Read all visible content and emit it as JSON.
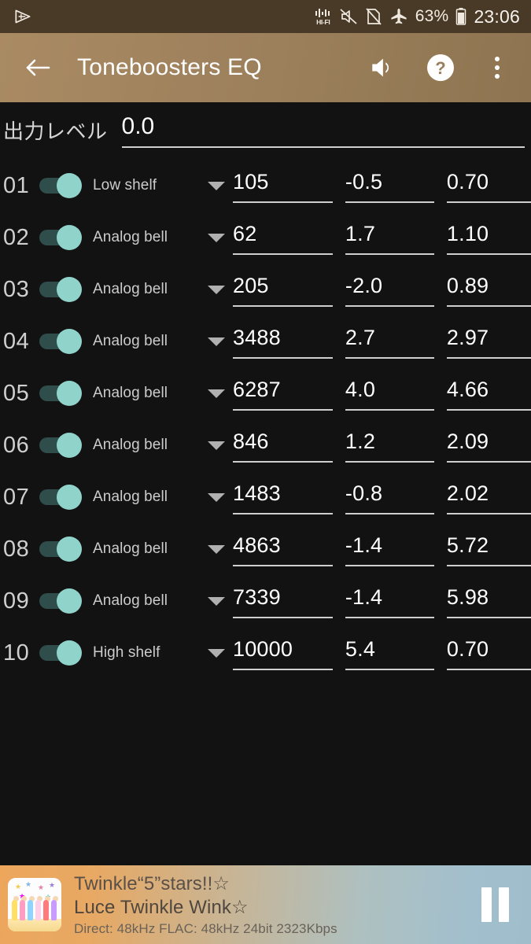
{
  "statusbar": {
    "icons": [
      "cast-icon",
      "hifi-icon",
      "volume-mute-icon",
      "no-sim-icon",
      "airplane-mode-icon"
    ],
    "hifi_label": "HI-FI",
    "battery_percent": "63%",
    "time": "23:06"
  },
  "toolbar": {
    "back_label": "back-arrow",
    "title": "Toneboosters EQ",
    "volume_label": "volume-icon",
    "help_label": "help-icon",
    "overflow_label": "overflow-menu-icon",
    "bg_start": "#a98a63",
    "bg_end": "#8e7450"
  },
  "output_level": {
    "label": "出力レベル",
    "value": "0.0"
  },
  "bands": [
    {
      "num": "01",
      "enabled": true,
      "type": "Low shelf",
      "freq": "105",
      "gain": "-0.5",
      "q": "0.70"
    },
    {
      "num": "02",
      "enabled": true,
      "type": "Analog bell",
      "freq": "62",
      "gain": "1.7",
      "q": "1.10"
    },
    {
      "num": "03",
      "enabled": true,
      "type": "Analog bell",
      "freq": "205",
      "gain": "-2.0",
      "q": "0.89"
    },
    {
      "num": "04",
      "enabled": true,
      "type": "Analog bell",
      "freq": "3488",
      "gain": "2.7",
      "q": "2.97"
    },
    {
      "num": "05",
      "enabled": true,
      "type": "Analog bell",
      "freq": "6287",
      "gain": "4.0",
      "q": "4.66"
    },
    {
      "num": "06",
      "enabled": true,
      "type": "Analog bell",
      "freq": "846",
      "gain": "1.2",
      "q": "2.09"
    },
    {
      "num": "07",
      "enabled": true,
      "type": "Analog bell",
      "freq": "1483",
      "gain": "-0.8",
      "q": "2.02"
    },
    {
      "num": "08",
      "enabled": true,
      "type": "Analog bell",
      "freq": "4863",
      "gain": "-1.4",
      "q": "5.72"
    },
    {
      "num": "09",
      "enabled": true,
      "type": "Analog bell",
      "freq": "7339",
      "gain": "-1.4",
      "q": "5.98"
    },
    {
      "num": "10",
      "enabled": true,
      "type": "High shelf",
      "freq": "10000",
      "gain": "5.4",
      "q": "0.70"
    }
  ],
  "player": {
    "title": "Twinkle“5”stars!!☆",
    "artist": "Luce Twinkle Wink☆",
    "meta": "Direct: 48kHz  FLAC: 48kHz  24bit   2323Kbps",
    "pause_label": "pause-button",
    "bg_start": "#eda65c",
    "bg_end": "#9fbdcb"
  },
  "theme": {
    "background": "#121212",
    "toggle_thumb": "#8fd3cb",
    "toggle_track": "#2f4d4a",
    "statusbar_bg": "#493a27"
  }
}
